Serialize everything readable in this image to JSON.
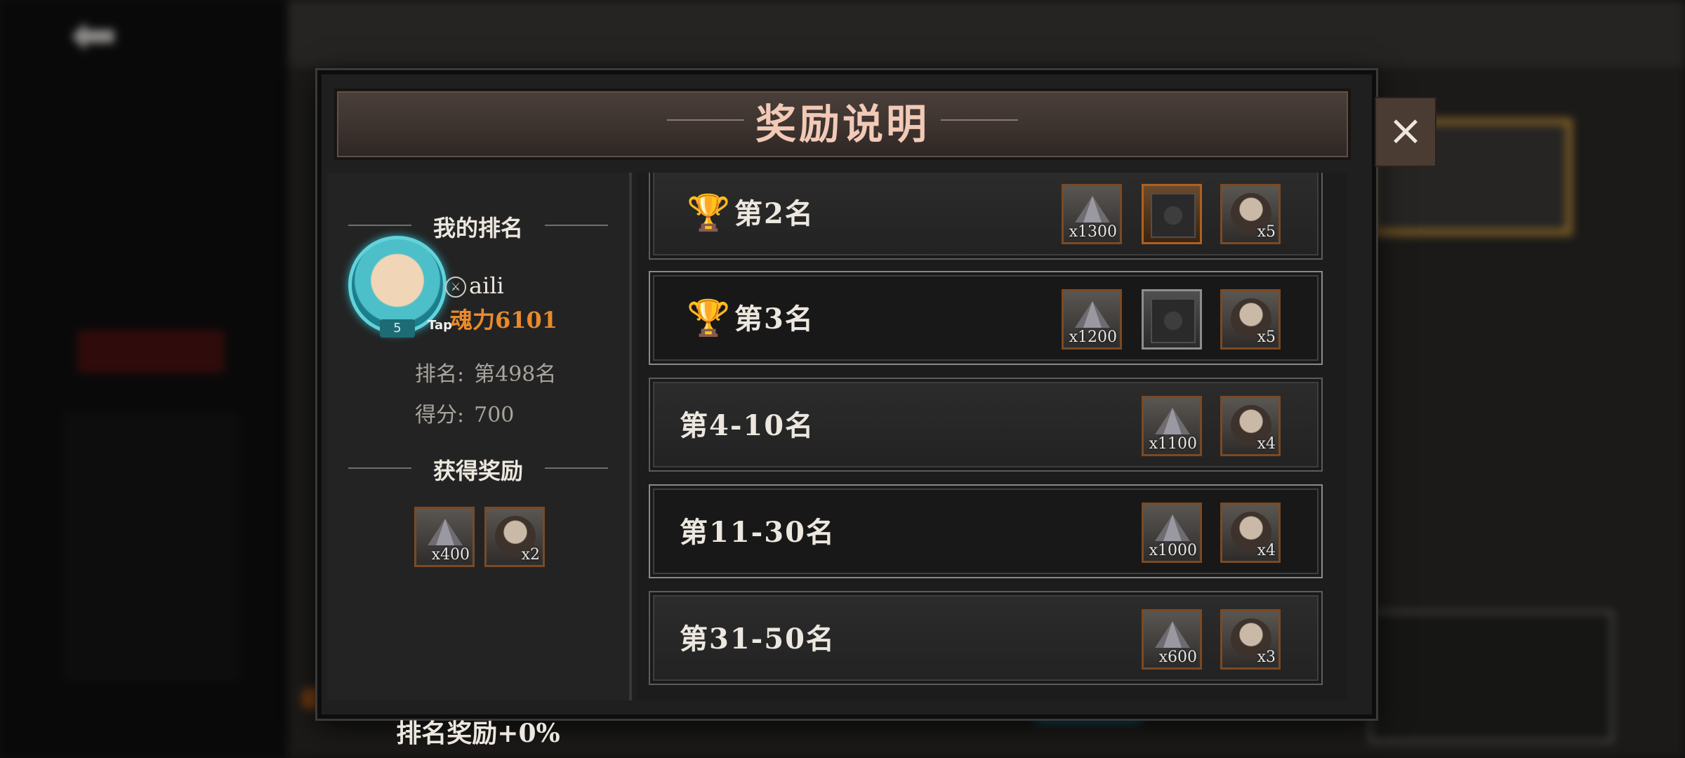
{
  "dialog": {
    "title": "奖励说明",
    "close_symbol": "×"
  },
  "my_rank": {
    "header": "我的排名",
    "avatar_level": "5",
    "avatar_tap": "Tap",
    "player_name": "aili",
    "player_power": "魂力6101",
    "rank_label": "排名:",
    "rank_value": "第498名",
    "score_label": "得分:",
    "score_value": "700",
    "rewards_header": "获得奖励",
    "rewards": [
      {
        "icon": "gem-ore-icon",
        "count": "x400"
      },
      {
        "icon": "character-face-icon",
        "count": "x2"
      }
    ],
    "bonus": "排名奖励+0%"
  },
  "rank_rewards": [
    {
      "label": "第2名",
      "trophy": "silver-trophy-icon",
      "rewards": [
        {
          "icon": "gem-ore-icon",
          "count": "x1300"
        },
        {
          "icon": "ornament-frame-icon",
          "count": ""
        },
        {
          "icon": "character-face-icon",
          "count": "x5"
        }
      ]
    },
    {
      "label": "第3名",
      "trophy": "bronze-trophy-icon",
      "rewards": [
        {
          "icon": "gem-ore-icon",
          "count": "x1200"
        },
        {
          "icon": "ornament-frame-icon",
          "count": ""
        },
        {
          "icon": "character-face-icon",
          "count": "x5"
        }
      ]
    },
    {
      "label": "第4-10名",
      "rewards": [
        {
          "icon": "gem-ore-icon",
          "count": "x1100"
        },
        {
          "icon": "character-face-icon",
          "count": "x4"
        }
      ]
    },
    {
      "label": "第11-30名",
      "rewards": [
        {
          "icon": "gem-ore-icon",
          "count": "x1000"
        },
        {
          "icon": "character-face-icon",
          "count": "x4"
        }
      ]
    },
    {
      "label": "第31-50名",
      "rewards": [
        {
          "icon": "gem-ore-icon",
          "count": "x600"
        },
        {
          "icon": "character-face-icon",
          "count": "x3"
        }
      ]
    }
  ],
  "background": {
    "back_arrow": "⬅",
    "highlight_color": "#b78a3a"
  }
}
